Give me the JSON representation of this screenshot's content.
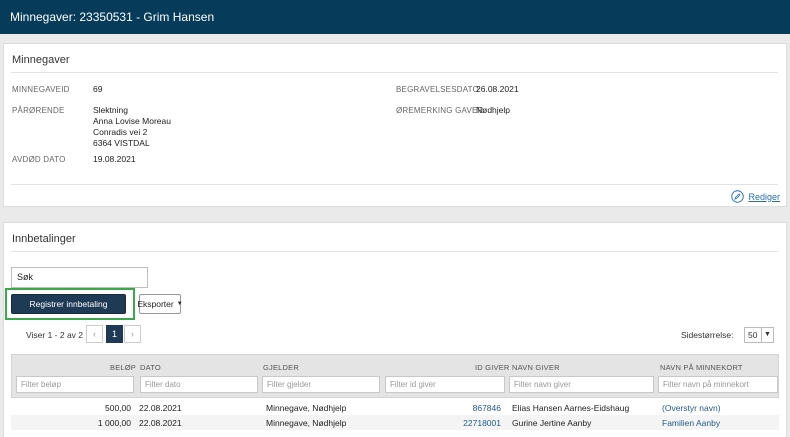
{
  "header": {
    "title": "Minnegaver: 23350531 - Grim Hansen"
  },
  "details": {
    "title": "Minnegaver",
    "fields": {
      "id_label": "MINNEGAVEID",
      "id_value": "69",
      "relative_label": "PÅRØRENDE",
      "relative_lines": [
        "Slektning",
        "Anna Lovise Moreau",
        "Conradis vei 2",
        "6364 VISTDAL"
      ],
      "death_label": "AVDØD DATO",
      "death_value": "19.08.2021",
      "burial_label": "BEGRAVELSESDATO",
      "burial_value": "26.08.2021",
      "earmark_label": "ØREMERKING GAVER",
      "earmark_value": "Nødhjelp"
    },
    "edit_label": "Rediger"
  },
  "payments": {
    "title": "Innbetalinger",
    "search_value": "Søk",
    "register_button": "Registrer innbetaling",
    "export_button": "Eksporter",
    "pager_text": "Viser 1 - 2 av 2",
    "pages": [
      "‹",
      "1",
      "›"
    ],
    "page_size_label": "Sidestørrelse:",
    "page_size_value": "50",
    "columns": [
      "BELØP",
      "DATO",
      "GJELDER",
      "ID GIVER",
      "NAVN GIVER",
      "NAVN PÅ MINNEKORT"
    ],
    "filters": [
      "Filter beløp",
      "Filter dato",
      "Filter gjelder",
      "Filter id giver",
      "Filter navn giver",
      "Filter navn på minnekort"
    ],
    "rows": [
      {
        "amount": "500,00",
        "date": "22.08.2021",
        "concerns": "Minnegave, Nødhjelp",
        "giver_id": "867846",
        "giver_name": "Elias Hansen Aarnes-Eidshaug",
        "card_name": "(Overstyr navn)"
      },
      {
        "amount": "1 000,00",
        "date": "22.08.2021",
        "concerns": "Minnegave, Nødhjelp",
        "giver_id": "22718001",
        "giver_name": "Gurine Jertine Aanby",
        "card_name": "Familien Aanby"
      }
    ]
  },
  "colors": {
    "header_bg": "#073b5a",
    "primary_button": "#1f3a55",
    "highlight": "#3aa84a",
    "link": "#2a6fb0"
  }
}
